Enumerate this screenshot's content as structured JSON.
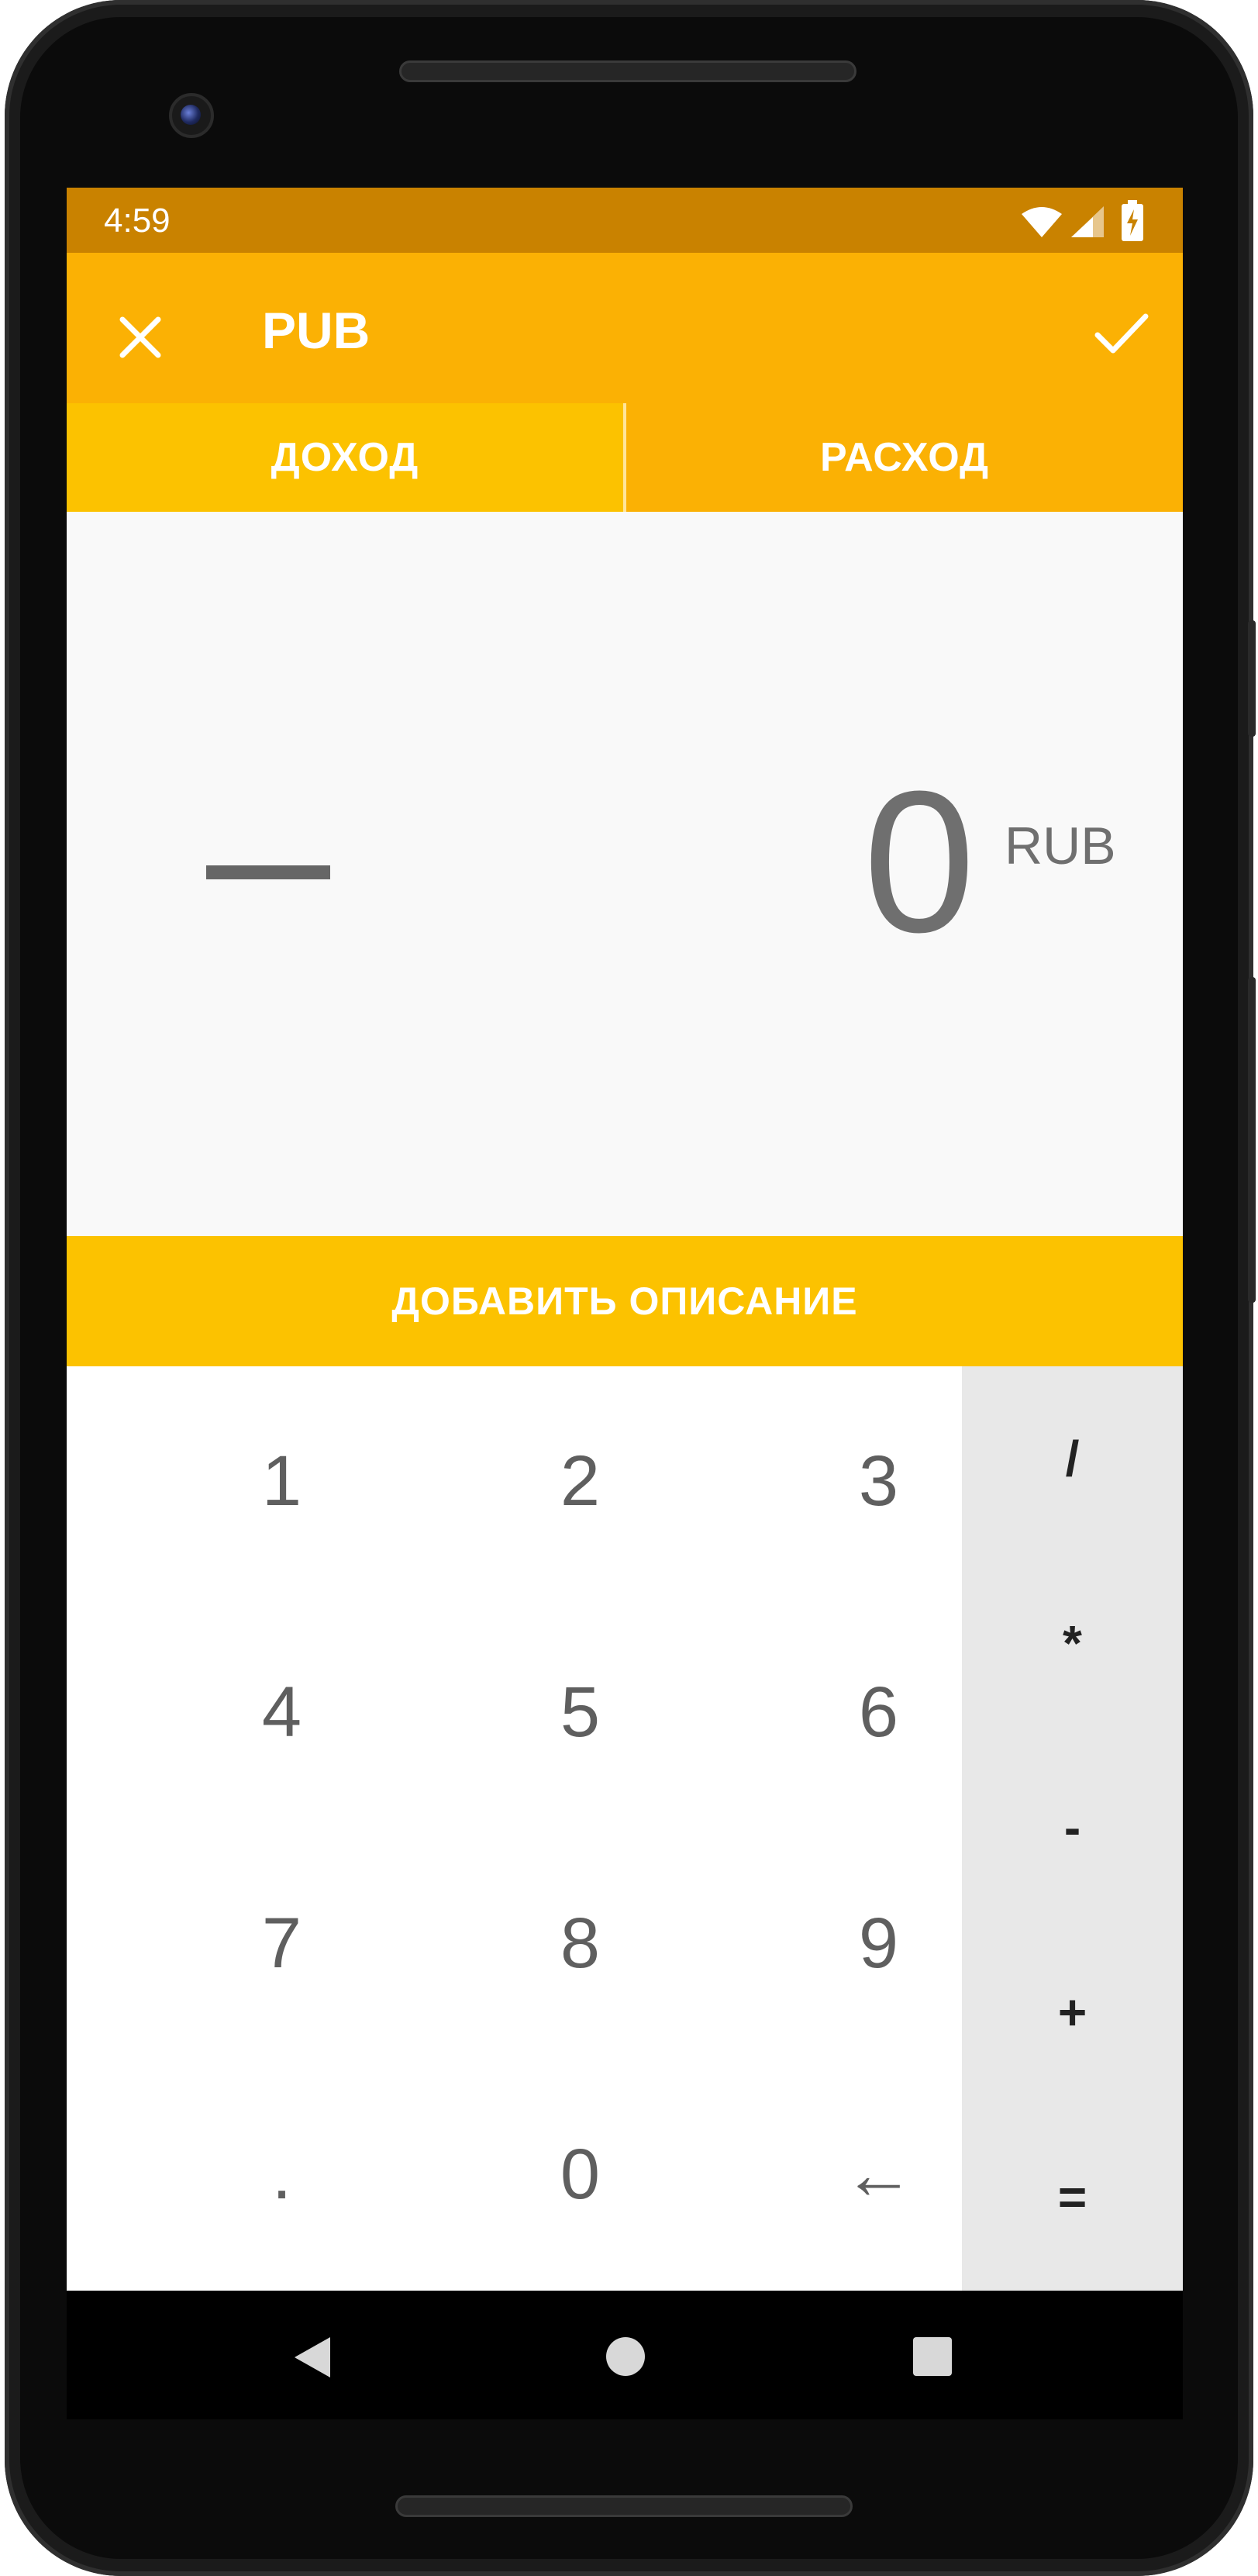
{
  "status_bar": {
    "time": "4:59"
  },
  "app_bar": {
    "title": "PUB"
  },
  "tabs": [
    {
      "label": "ДОХОД",
      "selected": true
    },
    {
      "label": "РАСХОД",
      "selected": false
    }
  ],
  "display": {
    "sign": "—",
    "amount": "0",
    "currency": "RUB"
  },
  "description_button": {
    "label": "ДОБАВИТЬ ОПИСАНИЕ"
  },
  "keypad": {
    "keys": [
      "1",
      "2",
      "3",
      "4",
      "5",
      "6",
      "7",
      "8",
      "9",
      ".",
      "0",
      "←"
    ],
    "operators": [
      "/",
      "*",
      "-",
      "+",
      "="
    ]
  },
  "colors": {
    "status_bar": "#c98200",
    "app_bar": "#fbb104",
    "tab_selected": "#fcc200",
    "accent": "#fcc200",
    "operator_panel": "#e8e8e8"
  },
  "icons": {
    "close": "close-icon",
    "confirm": "check-icon",
    "wifi": "wifi-icon",
    "signal": "signal-icon",
    "battery": "battery-charging-icon",
    "nav_back": "back-triangle-icon",
    "nav_home": "home-circle-icon",
    "nav_recents": "recents-square-icon"
  }
}
